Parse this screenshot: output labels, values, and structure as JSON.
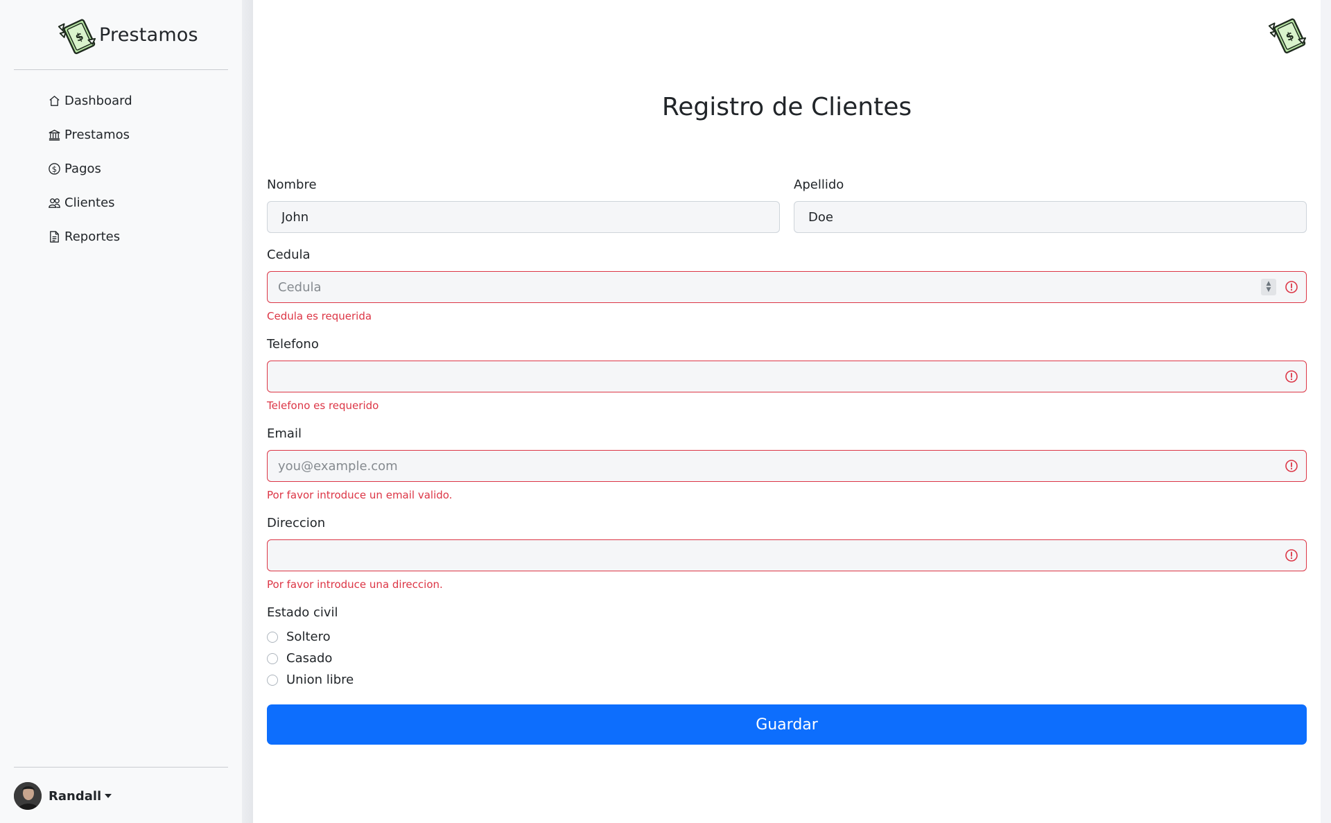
{
  "sidebar": {
    "brand": "Prestamos",
    "items": [
      {
        "label": "Dashboard",
        "icon": "home-icon"
      },
      {
        "label": "Prestamos",
        "icon": "bank-icon"
      },
      {
        "label": "Pagos",
        "icon": "dollar-circle-icon"
      },
      {
        "label": "Clientes",
        "icon": "people-icon"
      },
      {
        "label": "Reportes",
        "icon": "document-icon"
      }
    ],
    "user": {
      "name": "Randall"
    }
  },
  "page": {
    "title": "Registro de Clientes"
  },
  "form": {
    "nombre": {
      "label": "Nombre",
      "value": "John"
    },
    "apellido": {
      "label": "Apellido",
      "value": "Doe"
    },
    "cedula": {
      "label": "Cedula",
      "placeholder": "Cedula",
      "error": "Cedula es requerida"
    },
    "telefono": {
      "label": "Telefono",
      "error": "Telefono es requerido"
    },
    "email": {
      "label": "Email",
      "placeholder": "you@example.com",
      "error": "Por favor introduce un email valido."
    },
    "direccion": {
      "label": "Direccion",
      "error": "Por favor introduce una direccion."
    },
    "estado_civil": {
      "label": "Estado civil",
      "options": [
        "Soltero",
        "Casado",
        "Union libre"
      ]
    },
    "submit_label": "Guardar"
  },
  "colors": {
    "primary": "#0d6efd",
    "danger": "#dc3545",
    "sidebar_bg": "#f8f9fa"
  }
}
